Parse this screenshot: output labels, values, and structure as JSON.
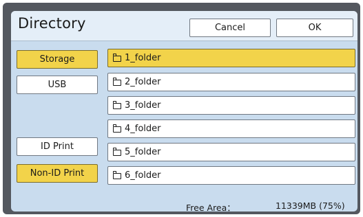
{
  "dialog": {
    "title": "Directory",
    "cancel_label": "Cancel",
    "ok_label": "OK"
  },
  "sidebar": {
    "storage_label": "Storage",
    "usb_label": "USB",
    "id_print_label": "ID Print",
    "non_id_print_label": "Non-ID Print"
  },
  "folders": [
    {
      "name": "1_folder",
      "selected": true
    },
    {
      "name": "2_folder"
    },
    {
      "name": "3_folder"
    },
    {
      "name": "4_folder"
    },
    {
      "name": "5_folder"
    },
    {
      "name": "6_folder"
    }
  ],
  "status": {
    "free_area_label": "Free Area：",
    "free_area_value": "11339MB (75%)"
  },
  "colors": {
    "selected": "#f2d34a",
    "panel": "#c9dcee",
    "frame": "#54585f"
  },
  "icons": {
    "folder": "folder-icon"
  }
}
